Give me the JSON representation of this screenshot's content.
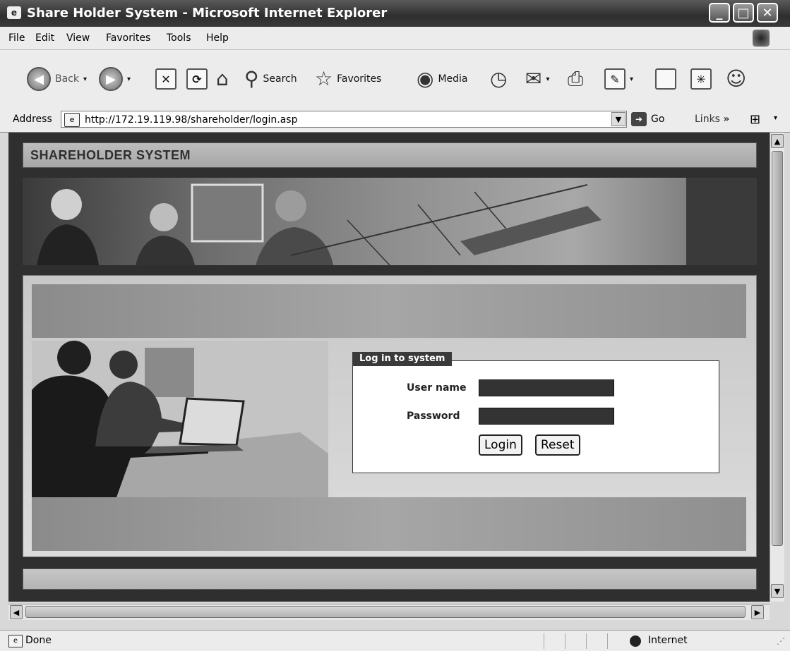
{
  "window": {
    "title": "Share Holder System - Microsoft Internet Explorer",
    "controls": [
      "minimize",
      "maximize",
      "close"
    ]
  },
  "menu": {
    "items": [
      "File",
      "Edit",
      "View",
      "Favorites",
      "Tools",
      "Help"
    ]
  },
  "toolbar": {
    "back_label": "Back",
    "search_label": "Search",
    "favorites_label": "Favorites",
    "media_label": "Media"
  },
  "address": {
    "label": "Address",
    "url": "http://172.19.119.98/shareholder/login.asp",
    "go_label": "Go",
    "links_label": "Links"
  },
  "page": {
    "header_title": "SHAREHOLDER SYSTEM",
    "login": {
      "legend": "Log in to system",
      "username_label": "User name",
      "password_label": "Password",
      "username_value": "",
      "password_value": "",
      "login_button": "Login",
      "reset_button": "Reset"
    }
  },
  "status": {
    "text": "Done",
    "zone": "Internet"
  },
  "colors": {
    "titlebar": "#3a3a3a",
    "page_background": "#2f2f2f",
    "input_fill": "#333333"
  }
}
